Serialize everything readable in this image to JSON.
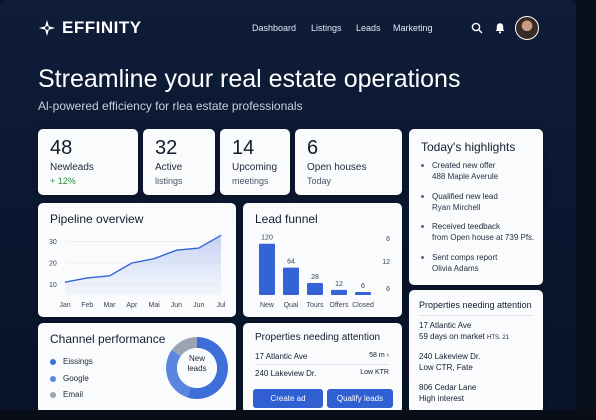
{
  "brand": {
    "name": "EFFINITY"
  },
  "nav": {
    "dashboard": "Dashboard",
    "listings": "Listings",
    "leads": "Leads",
    "marketing": "Marketing"
  },
  "icons": {
    "search": "search-icon",
    "bell": "bell-icon",
    "logo": "logo-mark-icon"
  },
  "hero": {
    "title": "Streamline your real estate operations",
    "subtitle": "Al-powered efficiency for rlea estate professionals"
  },
  "stats": [
    {
      "value": "48",
      "label": "Newleads",
      "sub": "+ 12%"
    },
    {
      "value": "32",
      "label": "Active",
      "sub": "listings"
    },
    {
      "value": "14",
      "label": "Upcoming",
      "sub": "meetings"
    },
    {
      "value": "6",
      "label": "Open houses",
      "sub": "Today"
    }
  ],
  "highlights": {
    "title": "Today's highlights",
    "items": [
      {
        "title": "Created new offer",
        "sub": "488 Maple Averule"
      },
      {
        "title": "Qualified new lead",
        "sub": "Ryan Mirchell"
      },
      {
        "title": "Received teedback",
        "sub": "from Open house at 739 Pfs."
      },
      {
        "title": "Sent comps report",
        "sub": "Olivia Adams"
      }
    ]
  },
  "pipeline": {
    "title": "Pipeline overview",
    "chart_data": {
      "type": "area",
      "categories": [
        "Jan",
        "Feb",
        "Mar",
        "Apr",
        "Mai",
        "Jun",
        "Jun",
        "Jul"
      ],
      "values": [
        11,
        13,
        14,
        20,
        22,
        26,
        27,
        33
      ],
      "yticks": [
        10,
        20,
        30
      ],
      "ylim": [
        5,
        35
      ]
    }
  },
  "funnel": {
    "title": "Lead funnel",
    "chart_data": {
      "type": "bar",
      "categories": [
        "New",
        "Qual",
        "Tours",
        "Offers",
        "Closed"
      ],
      "values": [
        120,
        64,
        28,
        12,
        6
      ],
      "right_labels": [
        "6",
        "12",
        "6"
      ],
      "ylim": [
        0,
        140
      ]
    }
  },
  "channel": {
    "title": "Channel performance",
    "legend": [
      {
        "label": "Eissings",
        "color": "#3e6fd8"
      },
      {
        "label": "Google",
        "color": "#5b86e0"
      },
      {
        "label": "Email",
        "color": "#9ba4b4"
      }
    ],
    "donut_label_1": "New",
    "donut_label_2": "leads",
    "chart_data": {
      "type": "pie",
      "categories": [
        "Eissings",
        "Google",
        "Email"
      ],
      "values": [
        55,
        30,
        15
      ]
    }
  },
  "attention": {
    "title": "Properties needing attention",
    "rows": [
      {
        "address": "17 Atlantic Ave",
        "note": "58 m ›"
      },
      {
        "address": "240 Lakeview Dr.",
        "note": "Low  KTR"
      }
    ],
    "create_ad": "Create ad",
    "qualify_leads": "Qualify leads"
  },
  "properties": {
    "title": "Properties needing attention",
    "items": [
      {
        "address": "17 Atlantic Ave",
        "detail": "59 days on market",
        "extra": "HTS.  21"
      },
      {
        "address": "240 Lakeview Dr.",
        "detail": "Low CTR, Fate",
        "extra": ""
      },
      {
        "address": "806 Cedar Lane",
        "detail": "High interest",
        "extra": ""
      }
    ]
  },
  "colors": {
    "accent": "#2f5fd0",
    "bar": "#3463d6",
    "background": "#0f1d38"
  }
}
